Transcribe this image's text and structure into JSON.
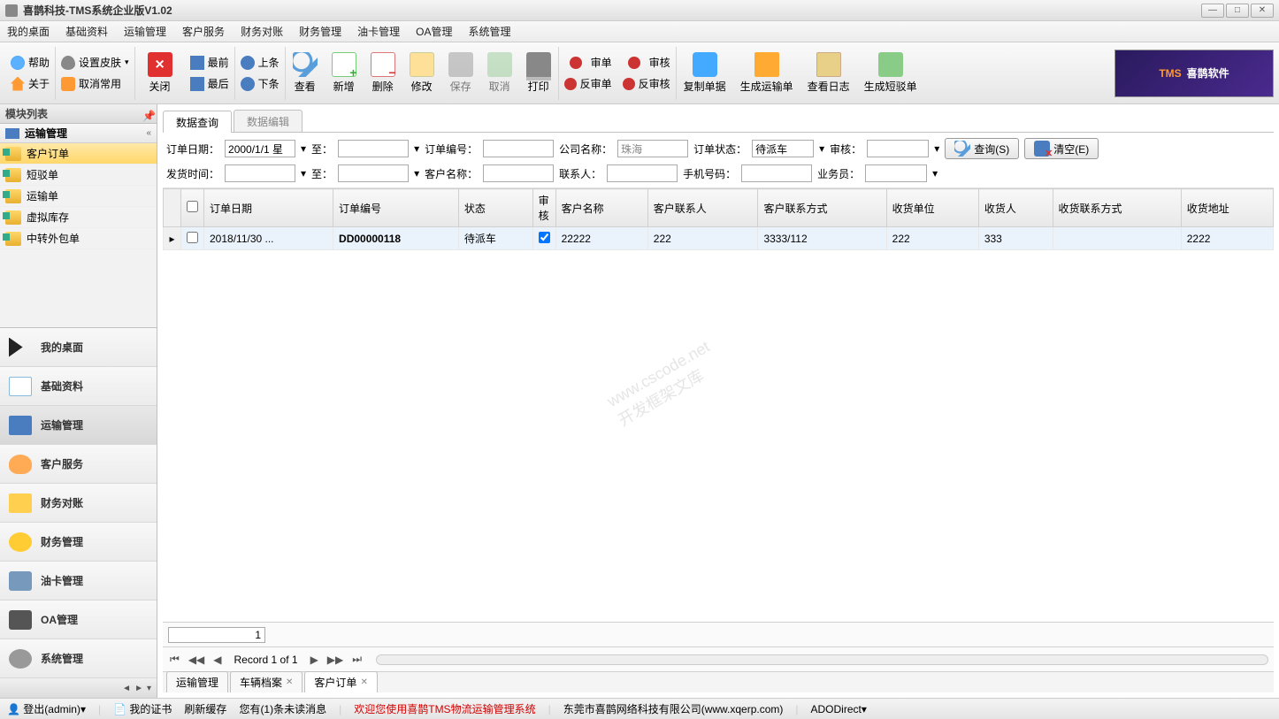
{
  "title": "喜鹊科技-TMS系统企业版V1.02",
  "menubar": [
    "我的桌面",
    "基础资料",
    "运输管理",
    "客户服务",
    "财务对账",
    "财务管理",
    "油卡管理",
    "OA管理",
    "系统管理"
  ],
  "toolbar_small": {
    "help": "帮助",
    "skin": "设置皮肤",
    "about": "关于",
    "cancel_common": "取消常用",
    "first": "最前",
    "last": "最后",
    "prev": "上条",
    "next": "下条"
  },
  "toolbar_large": {
    "close": "关闭",
    "view": "查看",
    "add": "新增",
    "del": "删除",
    "edit": "修改",
    "save": "保存",
    "cancel": "取消",
    "print": "打印",
    "audit": "审单",
    "approve": "审核",
    "unaudit": "反审单",
    "unapprove": "反审核",
    "copy": "复制单据",
    "gen_trans": "生成运输单",
    "viewlog": "查看日志",
    "gen_short": "生成短驳单"
  },
  "brand": {
    "tms": "TMS",
    "name": "喜鹊软件"
  },
  "sidebar": {
    "header": "模块列表",
    "navhead": "运输管理",
    "items": [
      "客户订单",
      "短驳单",
      "运输单",
      "虚拟库存",
      "中转外包单"
    ],
    "modules": [
      "我的桌面",
      "基础资料",
      "运输管理",
      "客户服务",
      "财务对账",
      "财务管理",
      "油卡管理",
      "OA管理",
      "系统管理"
    ]
  },
  "tabs": {
    "query": "数据查询",
    "edit": "数据编辑"
  },
  "filters": {
    "order_date": "订单日期：",
    "order_date_val": "2000/1/1 星",
    "to": "至：",
    "order_no": "订单编号：",
    "company": "公司名称：",
    "company_val": "珠海",
    "status": "订单状态：",
    "status_val": "待派车",
    "audit": "审核：",
    "ship_time": "发货时间：",
    "cust_name": "客户名称：",
    "contact": "联系人：",
    "mobile": "手机号码：",
    "salesman": "业务员：",
    "btn_query": "查询(S)",
    "btn_clear": "清空(E)"
  },
  "grid": {
    "headers": [
      "订单日期",
      "订单编号",
      "状态",
      "审核",
      "客户名称",
      "客户联系人",
      "客户联系方式",
      "收货单位",
      "收货人",
      "收货联系方式",
      "收货地址"
    ],
    "rows": [
      {
        "date": "2018/11/30 ...",
        "no": "DD00000118",
        "status": "待派车",
        "audit": true,
        "cust": "22222",
        "contact": "222",
        "contact_way": "3333/112",
        "recv_unit": "222",
        "recv": "333",
        "recv_way": "",
        "recv_addr": "2222"
      }
    ]
  },
  "pager": {
    "page": "1",
    "record": "Record 1 of 1"
  },
  "bottom_tabs": [
    {
      "label": "运输管理"
    },
    {
      "label": "车辆档案",
      "close": true
    },
    {
      "label": "客户订单",
      "close": true
    }
  ],
  "status": {
    "login": "登出(admin)",
    "cert": "我的证书",
    "refresh": "刷新缓存",
    "msg": "您有(1)条未读消息",
    "welcome": "欢迎您使用喜鹊TMS物流运输管理系统",
    "company": "东莞市喜鹊网络科技有限公司(www.xqerp.com)",
    "ado": "ADODirect"
  },
  "watermark": "www.cscode.net\n开发框架文库"
}
